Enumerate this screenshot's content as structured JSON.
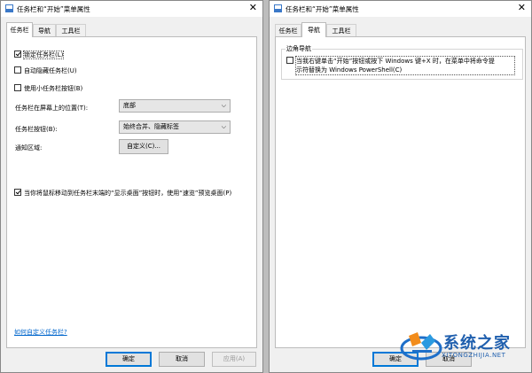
{
  "left_window": {
    "title": "任务栏和“开始”菜单属性",
    "tabs": [
      {
        "label": "任务栏",
        "active": true
      },
      {
        "label": "导航",
        "active": false
      },
      {
        "label": "工具栏",
        "active": false
      }
    ],
    "options": {
      "lock_taskbar": {
        "label": "锁定任务栏(L)",
        "checked": true
      },
      "auto_hide": {
        "label": "自动隐藏任务栏(U)",
        "checked": false
      },
      "small_buttons": {
        "label": "使用小任务栏按钮(B)",
        "checked": false
      },
      "peek": {
        "label": "当你将鼠标移动到任务栏末端的“显示桌面”按钮时，使用“速览”预览桌面(P)",
        "checked": true
      }
    },
    "location_label": "任务栏在屏幕上的位置(T):",
    "location_value": "底部",
    "buttons_label": "任务栏按钮(B):",
    "buttons_value": "始终合并、隐藏标签",
    "notify_label": "通知区域:",
    "customize_button": "自定义(C)...",
    "help_link": "如何自定义任务栏?",
    "ok": "确定",
    "cancel": "取消",
    "apply": "应用(A)"
  },
  "right_window": {
    "title": "任务栏和“开始”菜单属性",
    "tabs": [
      {
        "label": "任务栏",
        "active": false
      },
      {
        "label": "导航",
        "active": true
      },
      {
        "label": "工具栏",
        "active": false
      }
    ],
    "group_title": "边角导航",
    "option_line1": "当我右键单击“开始”按钮或按下 Windows 键+X 时，在菜单中将命令提",
    "option_line2": "示符替换为 Windows PowerShell(C)",
    "option_checked": false,
    "ok": "确定",
    "cancel": "取消"
  },
  "watermark": {
    "text": "系统之家",
    "url": "XITONGZHIJIA.NET"
  }
}
